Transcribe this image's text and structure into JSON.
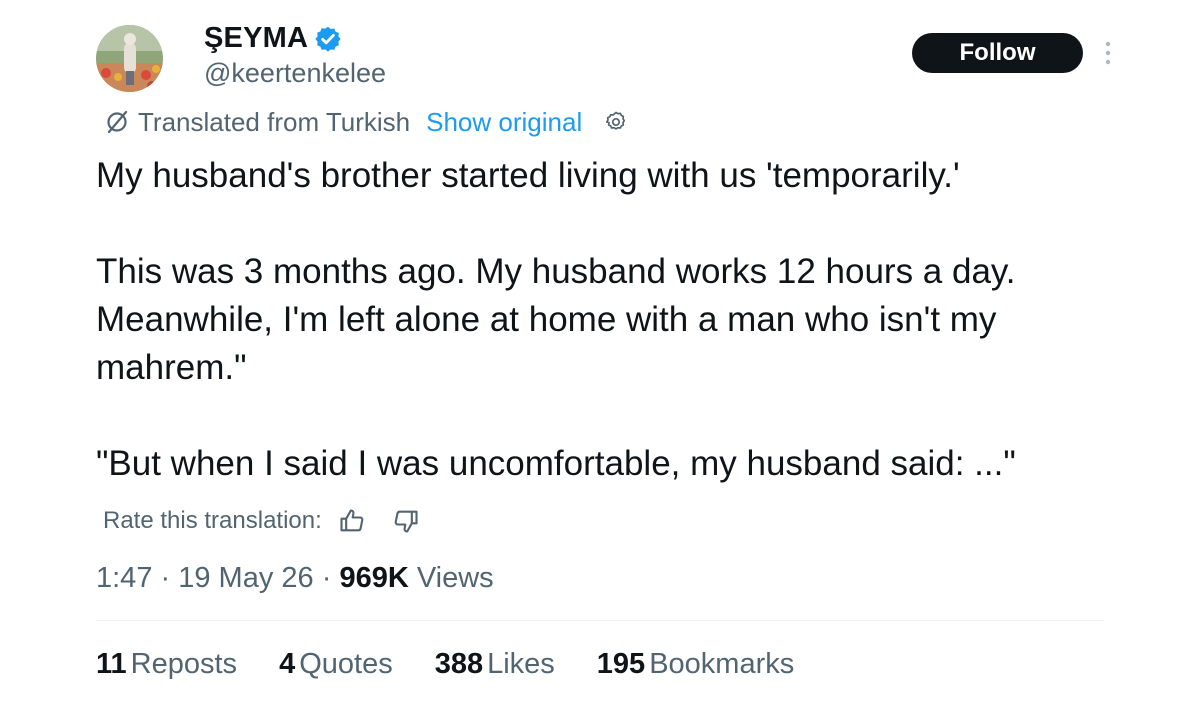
{
  "author": {
    "display_name": "ŞEYMA",
    "handle": "@keertenkelee",
    "verified": true,
    "verified_color": "#1d9bf0"
  },
  "follow_button": {
    "label": "Follow"
  },
  "more_menu": {
    "icon": "more-vertical-icon"
  },
  "translation": {
    "label": "Translated from Turkish",
    "show_original": "Show original",
    "icon": "translate-icon",
    "settings_icon": "gear-icon"
  },
  "tweet": {
    "paragraphs": [
      {
        "lines": [
          "My husband's brother started living with us 'temporarily.'"
        ]
      },
      {
        "lines": [
          "This was 3 months ago. My husband works 12 hours a day.",
          "Meanwhile, I'm left alone at home with a man who isn't my",
          "mahrem.\""
        ]
      },
      {
        "lines": [
          "\"But when I said I was uncomfortable, my husband said: ...\""
        ]
      }
    ]
  },
  "rate": {
    "label": "Rate this translation:",
    "thumbs_up_icon": "thumbs-up-icon",
    "thumbs_down_icon": "thumbs-down-icon"
  },
  "meta": {
    "time": "1:47",
    "separator": "·",
    "date": "19 May 26",
    "views_count": "969K",
    "views_label": "Views"
  },
  "stats": [
    {
      "count": "11",
      "label": "Reposts"
    },
    {
      "count": "4",
      "label": "Quotes"
    },
    {
      "count": "388",
      "label": "Likes"
    },
    {
      "count": "195",
      "label": "Bookmarks"
    }
  ],
  "colors": {
    "text_primary": "#0f1419",
    "text_secondary": "#536471",
    "accent": "#1d9bf0",
    "follow_bg": "#0f1419"
  }
}
